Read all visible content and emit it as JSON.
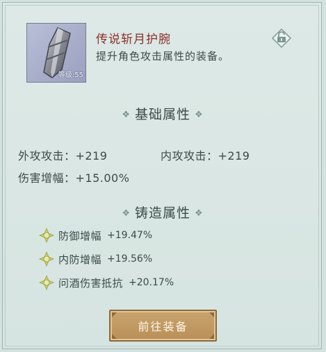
{
  "item": {
    "name": "传说斩月护腕",
    "description": "提升角色攻击属性的装备。",
    "level_label": "等级:55"
  },
  "sections": {
    "basic_title": "基础属性",
    "forge_title": "铸造属性"
  },
  "basic_stats": {
    "outer_attack_label": "外攻攻击：",
    "outer_attack_value": "+219",
    "inner_attack_label": "内攻攻击：",
    "inner_attack_value": "+219",
    "damage_boost_label": "伤害增幅：",
    "damage_boost_value": "+15.00%"
  },
  "forge_stats": [
    {
      "label": "防御增幅",
      "value": "+19.47%"
    },
    {
      "label": "内防增幅",
      "value": "+19.56%"
    },
    {
      "label": "问酒伤害抵抗",
      "value": "+20.17%"
    }
  ],
  "actions": {
    "equip_label": "前往装备"
  },
  "colors": {
    "panel_bg": "#d6e4e1",
    "item_name": "#8a2f2a",
    "button_gold": "#c9a36e"
  }
}
